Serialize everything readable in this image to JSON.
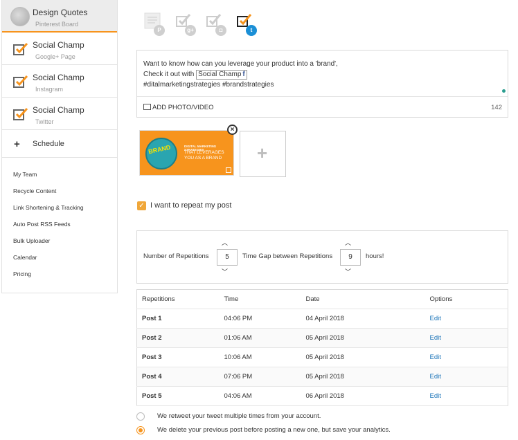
{
  "sidebar": {
    "accounts": [
      {
        "name": "Design Quotes",
        "sub": "Pinterest Board",
        "active": true
      },
      {
        "name": "Social Champ",
        "sub": "Google+ Page"
      },
      {
        "name": "Social Champ",
        "sub": "Instagram"
      },
      {
        "name": "Social Champ",
        "sub": "Twitter"
      }
    ],
    "schedule": {
      "icon": "plus-icon",
      "label": "Schedule"
    },
    "menu": [
      "My Team",
      "Recycle Content",
      "Link Shortening & Tracking",
      "Auto Post RSS Feeds",
      "Bulk Uploader",
      "Calendar",
      "Pricing"
    ]
  },
  "networks": [
    {
      "icon": "pinterest-icon",
      "badge": "P",
      "selected": false
    },
    {
      "icon": "google-plus-icon",
      "badge": "g+",
      "selected": false
    },
    {
      "icon": "instagram-icon",
      "badge": "◘",
      "selected": false
    },
    {
      "icon": "twitter-icon",
      "badge": "t",
      "selected": true
    }
  ],
  "composer": {
    "line1": "Want to know how can you leverage your product into a 'brand',",
    "line2_prefix": "Check it out with",
    "mention": "Social Champ",
    "mention_icon": "f",
    "line3": "#ditalmarketingstrategies #brandstrategies",
    "add_media": "ADD PHOTO/VIDEO",
    "char_count": "142"
  },
  "media": {
    "globe_text": "BRAND",
    "line1": "DIGITAL MARKETING STRATEGIES",
    "line2": "THAT LEVERAGES YOU AS A BRAND",
    "remove": "×",
    "add": "+"
  },
  "repeat": {
    "checkbox": "✓",
    "label": "I want to repeat my post"
  },
  "repetitions": {
    "number_label": "Number of Repetitions",
    "number_value": "5",
    "gap_label": "Time Gap between Repetitions",
    "gap_value": "9",
    "unit": "hours!",
    "up": "︿",
    "down": "﹀"
  },
  "table": {
    "headers": [
      "Repetitions",
      "Time",
      "Date",
      "Options"
    ],
    "rows": [
      {
        "post": "Post 1",
        "time": "04:06 PM",
        "date": "04 April 2018",
        "option": "Edit"
      },
      {
        "post": "Post 2",
        "time": "01:06 AM",
        "date": "05 April 2018",
        "option": "Edit"
      },
      {
        "post": "Post 3",
        "time": "10:06 AM",
        "date": "05 April 2018",
        "option": "Edit"
      },
      {
        "post": "Post 4",
        "time": "07:06 PM",
        "date": "05 April 2018",
        "option": "Edit"
      },
      {
        "post": "Post 5",
        "time": "04:06 AM",
        "date": "06 April 2018",
        "option": "Edit"
      }
    ]
  },
  "options": [
    {
      "text": "We retweet your tweet multiple times from your account.",
      "selected": false
    },
    {
      "text": "We delete your previous post before posting a new one, but save your analytics.",
      "selected": true
    }
  ],
  "colors": {
    "accent": "#f7941d",
    "link": "#1a73b8",
    "twitter": "#1b8fd6"
  }
}
